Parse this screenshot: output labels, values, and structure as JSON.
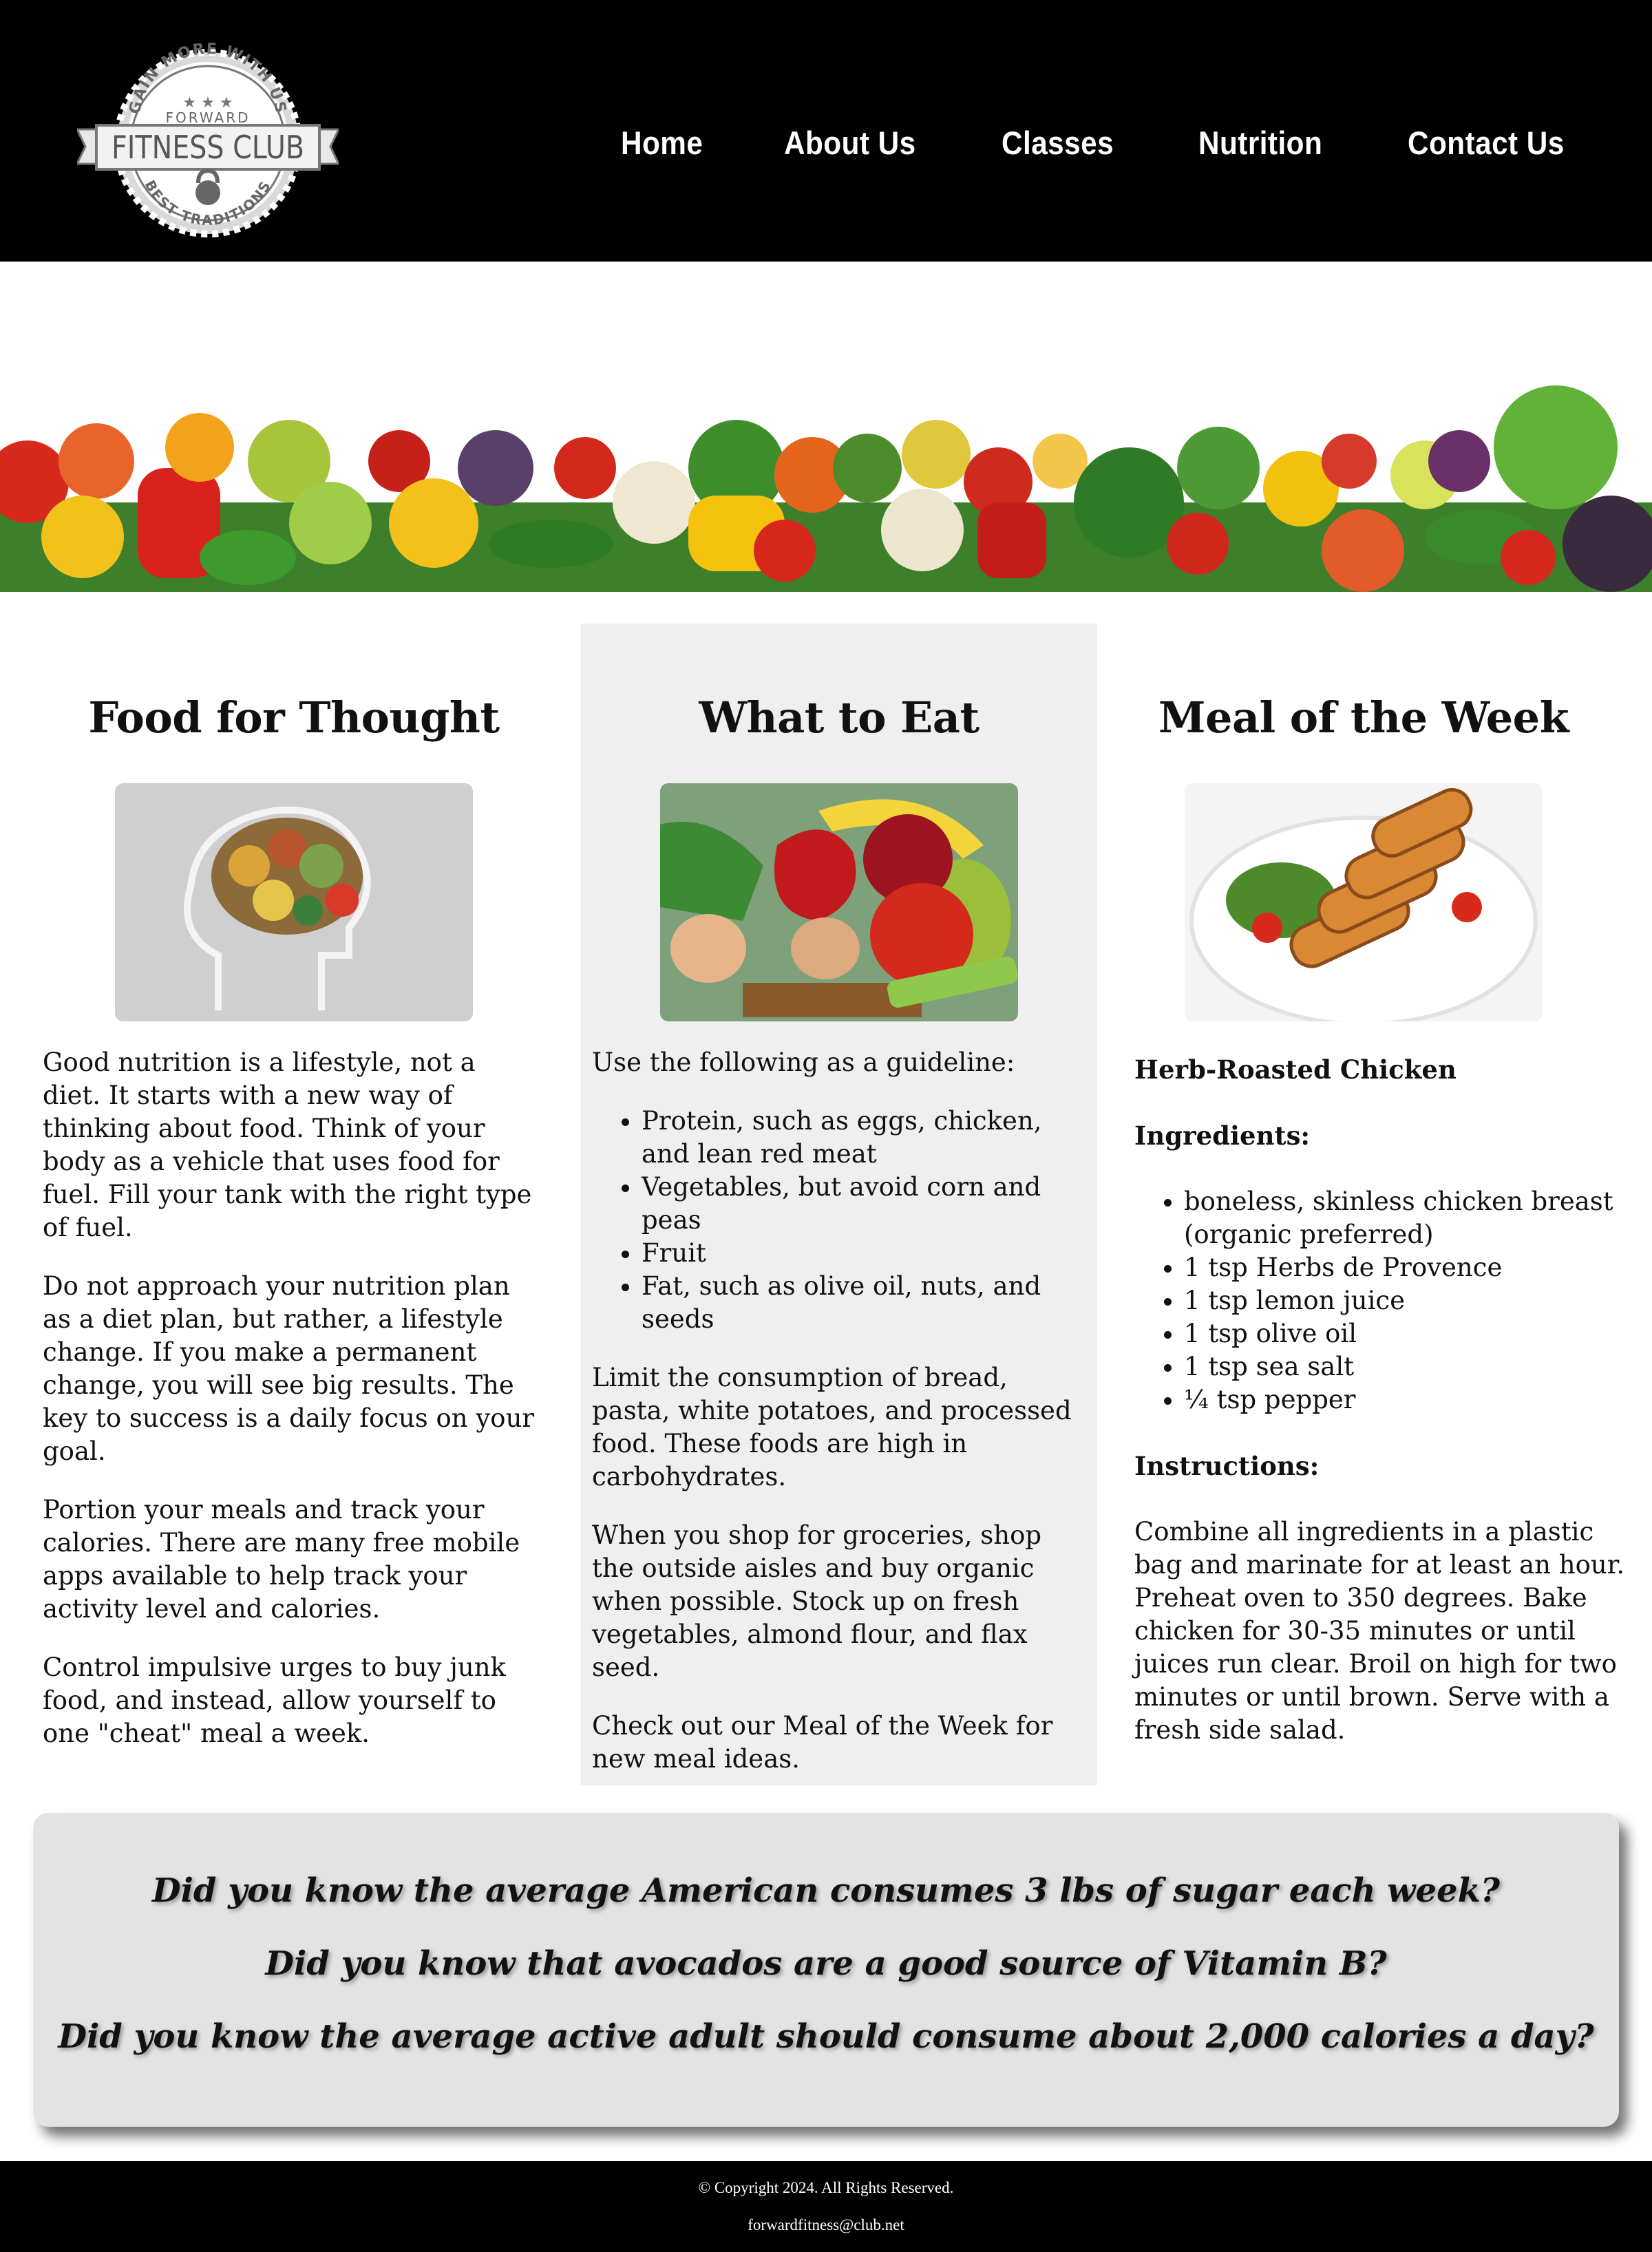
{
  "logo": {
    "top_arc": "GAIN MORE WITH US",
    "brand_small": "FORWARD",
    "brand_name": "FITNESS CLUB",
    "bottom_arc": "BEST TRADITIONS"
  },
  "nav": {
    "items": [
      "Home",
      "About Us",
      "Classes",
      "Nutrition",
      "Contact Us"
    ]
  },
  "columns": {
    "left": {
      "title": "Food for Thought",
      "paragraphs": [
        "Good nutrition is a lifestyle, not a diet. It starts with a new way of thinking about food. Think of your body as a vehicle that uses food for fuel. Fill your tank with the right type of fuel.",
        "Do not approach your nutrition plan as a diet plan, but rather, a lifestyle change. If you make a permanent change, you will see big results. The key to success is a daily focus on your goal.",
        "Portion your meals and track your calories. There are many free mobile apps available to help track your activity level and calories.",
        "Control impulsive urges to buy junk food, and instead, allow yourself to one \"cheat\" meal a week."
      ]
    },
    "middle": {
      "title": "What to Eat",
      "intro": "Use the following as a guideline:",
      "list": [
        "Protein, such as eggs, chicken, and lean red meat",
        "Vegetables, but avoid corn and peas",
        "Fruit",
        "Fat, such as olive oil, nuts, and seeds"
      ],
      "paragraphs": [
        "Limit the consumption of bread, pasta, white potatoes, and processed food. These foods are high in carbohydrates.",
        "When you shop for groceries, shop the outside aisles and buy organic when possible. Stock up on fresh vegetables, almond flour, and flax seed.",
        "Check out our Meal of the Week for new meal ideas."
      ]
    },
    "right": {
      "title": "Meal of the Week",
      "dish": "Herb-Roasted Chicken",
      "ingredients_heading": "Ingredients:",
      "ingredients": [
        "boneless, skinless chicken breast (organic preferred)",
        "1 tsp Herbs de Provence",
        "1 tsp lemon juice",
        "1 tsp olive oil",
        "1 tsp sea salt",
        "¼ tsp pepper"
      ],
      "instructions_heading": "Instructions:",
      "instructions": "Combine all ingredients in a plastic bag and marinate for at least an hour. Preheat oven to 350 degrees. Bake chicken for 30-35 minutes or until juices run clear. Broil on high for two minutes or until brown. Serve with a fresh side salad."
    }
  },
  "facts": [
    "Did you know the average American consumes 3 lbs of sugar each week?",
    "Did you know that avocados are a good source of Vitamin B?",
    "Did you know the average active adult should consume about 2,000 calories a day?"
  ],
  "footer": {
    "copyright": "© Copyright 2024. All Rights Reserved.",
    "email": "forwardfitness@club.net"
  }
}
